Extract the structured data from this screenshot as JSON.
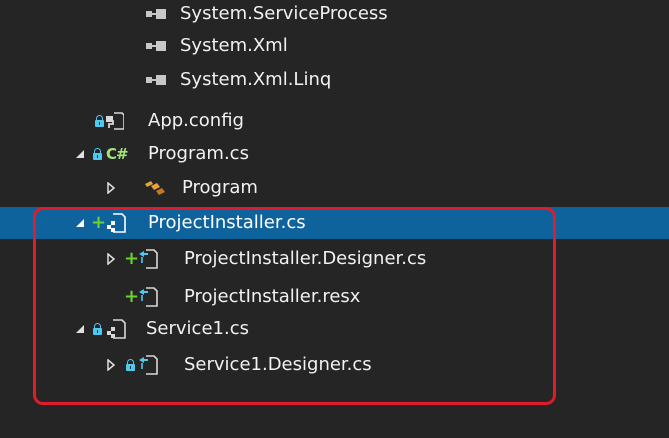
{
  "solution_tree": {
    "items": [
      {
        "label": "System.ServiceProcess",
        "icon": "reference-icon"
      },
      {
        "label": "System.Xml",
        "icon": "reference-icon"
      },
      {
        "label": "System.Xml.Linq",
        "icon": "reference-icon"
      },
      {
        "label": "App.config",
        "icon": "config-file-icon"
      },
      {
        "label": "Program.cs",
        "icon": "csharp-file-icon"
      },
      {
        "label": "Program",
        "icon": "class-icon"
      },
      {
        "label": "ProjectInstaller.cs",
        "icon": "component-file-icon"
      },
      {
        "label": "ProjectInstaller.Designer.cs",
        "icon": "designer-file-icon"
      },
      {
        "label": "ProjectInstaller.resx",
        "icon": "resource-file-icon"
      },
      {
        "label": "Service1.cs",
        "icon": "component-file-icon"
      },
      {
        "label": "Service1.Designer.cs",
        "icon": "designer-file-icon"
      }
    ],
    "selected_label": "ProjectInstaller.cs"
  },
  "colors": {
    "background": "#252526",
    "selection": "#0e639c",
    "highlight_box": "#e11a2c",
    "added_marker": "#6bd32f",
    "lock_marker": "#4ec9f0"
  }
}
